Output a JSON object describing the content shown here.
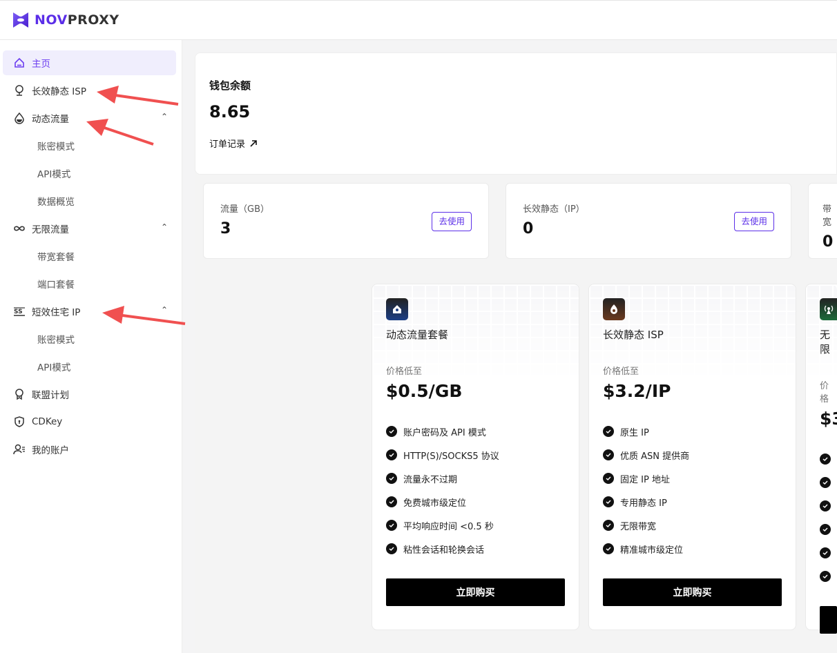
{
  "brand": {
    "name_a": "NOV",
    "name_b": "PROXY",
    "accent": "#5b2ee8"
  },
  "sidebar": {
    "items": [
      {
        "label": "主页",
        "icon": "home-icon",
        "active": true
      },
      {
        "label": "长效静态 ISP",
        "icon": "location-pin-icon"
      },
      {
        "label": "动态流量",
        "icon": "drop-icon",
        "expanded": true
      },
      {
        "label": "账密模式",
        "sub": true
      },
      {
        "label": "API模式",
        "sub": true
      },
      {
        "label": "数据概览",
        "sub": true
      },
      {
        "label": "无限流量",
        "icon": "infinity-icon",
        "expanded": true
      },
      {
        "label": "带宽套餐",
        "sub": true
      },
      {
        "label": "端口套餐",
        "sub": true
      },
      {
        "label": "短效住宅 IP",
        "icon": "ss-icon",
        "expanded": true
      },
      {
        "label": "账密模式",
        "sub": true
      },
      {
        "label": "API模式",
        "sub": true
      },
      {
        "label": "联盟计划",
        "icon": "award-icon"
      },
      {
        "label": "CDKey",
        "icon": "shield-icon"
      },
      {
        "label": "我的账户",
        "icon": "user-list-icon"
      }
    ]
  },
  "wallet": {
    "title": "钱包余额",
    "value": "8.65",
    "orders_link": "订单记录"
  },
  "stats": [
    {
      "title": "流量（GB）",
      "value": "3",
      "button": "去使用"
    },
    {
      "title": "长效静态（IP）",
      "value": "0",
      "button": "去使用"
    },
    {
      "title": "带宽",
      "value": "0"
    }
  ],
  "plans": [
    {
      "name": "动态流量套餐",
      "price_label": "价格低至",
      "price": "$0.5/GB",
      "icon": "home-pin-icon",
      "color": "#1d3f86",
      "features": [
        "账户密码及 API 模式",
        "HTTP(S)/SOCKS5 协议",
        "流量永不过期",
        "免费城市级定位",
        "平均响应时间 <0.5 秒",
        "粘性会话和轮换会话"
      ],
      "buy": "立即购买"
    },
    {
      "name": "长效静态 ISP",
      "price_label": "价格低至",
      "price": "$3.2/IP",
      "icon": "fire-icon",
      "color": "#6b3a1f",
      "features": [
        "原生 IP",
        "优质 ASN 提供商",
        "固定 IP 地址",
        "专用静态 IP",
        "无限带宽",
        "精准城市级定位"
      ],
      "buy": "立即购买"
    },
    {
      "name": "无限",
      "price_label": "价格",
      "price": "$3",
      "icon": "antenna-icon",
      "color": "#1d6b3a",
      "features": [
        "",
        "",
        "",
        "",
        "",
        ""
      ],
      "buy": ""
    }
  ]
}
